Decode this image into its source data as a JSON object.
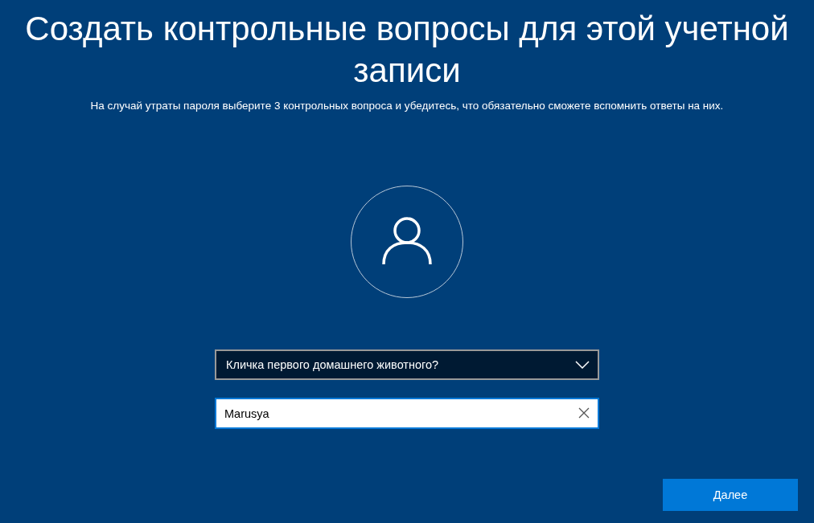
{
  "title": "Создать контрольные вопросы для этой учетной записи",
  "subtitle": "На случай утраты пароля выберите 3 контрольных вопроса и убедитесь, что обязательно сможете вспомнить ответы на них.",
  "question_dropdown": {
    "value": "Кличка первого домашнего животного?"
  },
  "answer_field": {
    "value": "Marusya"
  },
  "next_button": {
    "label": "Далее"
  }
}
